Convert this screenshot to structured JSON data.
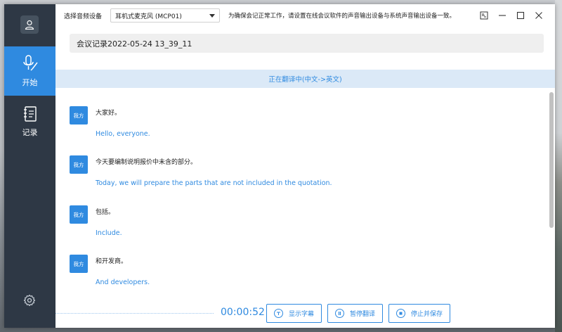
{
  "titlebar": {
    "device_label": "选择音频设备",
    "device_value": "耳机式麦克风 (MCP01)",
    "hint": "为确保会记正常工作，请设置在线会议软件的声音输出设备与系统声音输出设备一致。"
  },
  "sidebar": {
    "items": [
      {
        "label": "开始",
        "icon": "mic-pen-icon",
        "active": true
      },
      {
        "label": "记录",
        "icon": "notebook-icon",
        "active": false
      }
    ]
  },
  "record_title": "会议记录2022-05-24 13_39_11",
  "status": "正在翻译中(中文->英文)",
  "messages": [
    {
      "speaker": "我方",
      "source": "大家好。",
      "translation": "Hello, everyone."
    },
    {
      "speaker": "我方",
      "source": "今天要编制说明报价中未含的部分。",
      "translation": "Today, we will prepare the parts that are not included in the quotation."
    },
    {
      "speaker": "我方",
      "source": "包括。",
      "translation": "Include."
    },
    {
      "speaker": "我方",
      "source": "和开发商。",
      "translation": "And developers."
    }
  ],
  "footer": {
    "timer": "00:00:52",
    "show_subtitles": "显示字幕",
    "pause_translation": "暂停翻译",
    "stop_save": "停止并保存"
  },
  "colors": {
    "accent": "#2f8ae0",
    "sidebar": "#2e3845",
    "status_bg": "#dbe9f7"
  }
}
